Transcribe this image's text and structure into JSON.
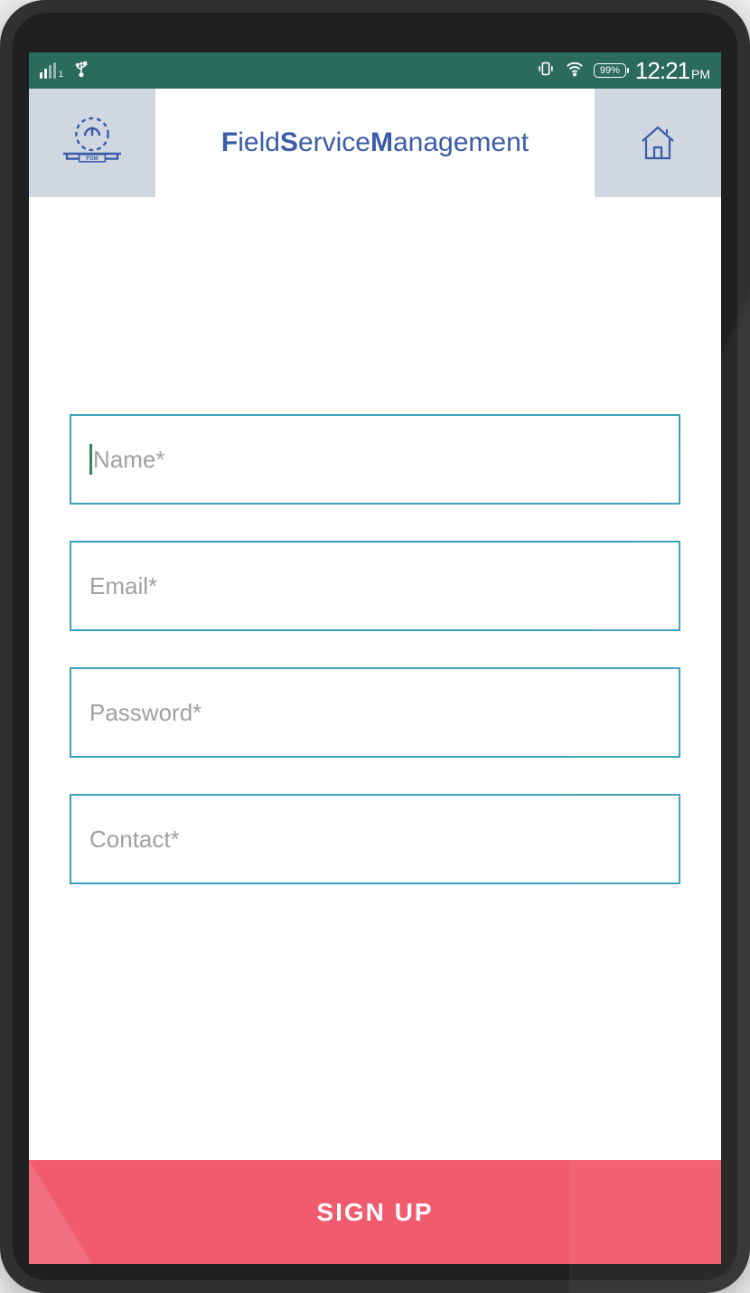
{
  "status": {
    "signal_sub": "1",
    "battery": "99%",
    "time": "12:21",
    "ampm": "PM"
  },
  "header": {
    "title_parts": [
      "F",
      "ield ",
      "S",
      "ervice ",
      "M",
      "anagement"
    ],
    "logo_label": "FSM"
  },
  "form": {
    "name": {
      "placeholder": "Name*",
      "value": ""
    },
    "email": {
      "placeholder": "Email*",
      "value": ""
    },
    "password": {
      "placeholder": "Password*",
      "value": ""
    },
    "contact": {
      "placeholder": "Contact*",
      "value": ""
    }
  },
  "actions": {
    "signup_label": "SIGN UP"
  },
  "colors": {
    "status_bg": "#2a6b5c",
    "accent_border": "#3a9fba",
    "title_color": "#3a5ca8",
    "button_bg": "#f05c6e",
    "panel_bg": "#d1d7e0"
  }
}
